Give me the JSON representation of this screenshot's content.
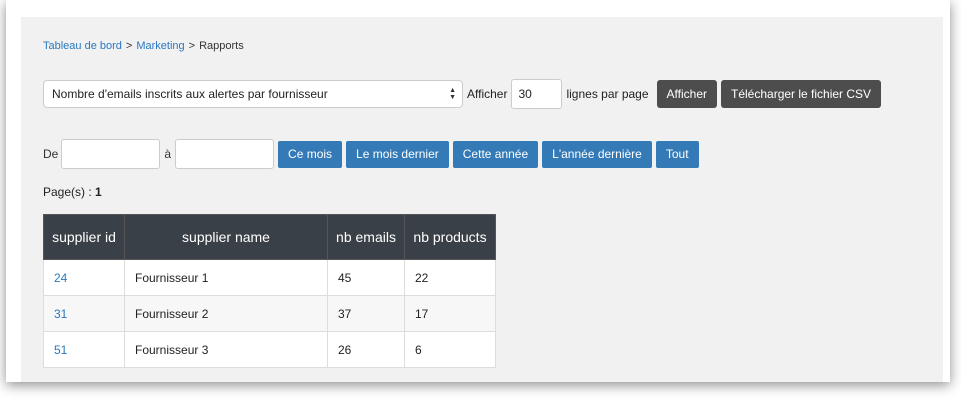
{
  "breadcrumb": {
    "items": [
      {
        "label": "Tableau de bord",
        "link": true
      },
      {
        "label": "Marketing",
        "link": true
      },
      {
        "label": "Rapports",
        "link": false
      }
    ],
    "separator": ">"
  },
  "report": {
    "select_value": "Nombre d'emails inscrits aux alertes par fournisseur",
    "show_label": "Afficher",
    "rows_value": "30",
    "rows_suffix": "lignes par page",
    "show_button": "Afficher",
    "csv_button": "Télécharger le fichier CSV"
  },
  "date_filter": {
    "from_label": "De",
    "to_label": "à",
    "from_value": "",
    "to_value": "",
    "buttons": [
      "Ce mois",
      "Le mois dernier",
      "Cette année",
      "L'année dernière",
      "Tout"
    ]
  },
  "pagination": {
    "label": "Page(s) :",
    "pages": "1"
  },
  "table": {
    "headers": [
      "supplier id",
      "supplier name",
      "nb emails",
      "nb products"
    ],
    "rows": [
      [
        "24",
        "Fournisseur 1",
        "45",
        "22"
      ],
      [
        "31",
        "Fournisseur 2",
        "37",
        "17"
      ],
      [
        "51",
        "Fournisseur 3",
        "26",
        "6"
      ]
    ]
  },
  "colors": {
    "link": "#2a78c0",
    "primary_button": "#337ab7",
    "dark_button": "#4d4d4d",
    "table_header": "#3a4047"
  }
}
